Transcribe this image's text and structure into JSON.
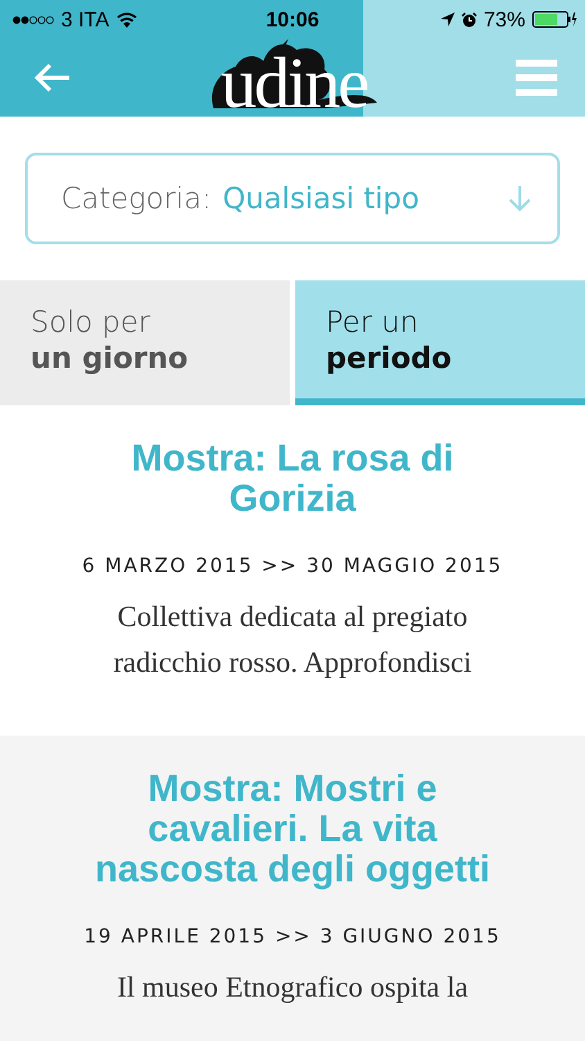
{
  "status_bar": {
    "carrier": "3 ITA",
    "time": "10:06",
    "battery": "73%"
  },
  "header": {
    "logo": "udine"
  },
  "filter": {
    "label": "Categoria:",
    "value": "Qualsiasi tipo"
  },
  "tabs": [
    {
      "lines": [
        "Solo per",
        "un giorno"
      ],
      "selected": false
    },
    {
      "lines": [
        "Per un",
        "periodo"
      ],
      "selected": true
    }
  ],
  "events": [
    {
      "title": "Mostra: La rosa di Gorizia",
      "dates": "6 MARZO 2015 >> 30 MAGGIO 2015",
      "description": "Collettiva dedicata al pregiato radicchio rosso. Approfondisci"
    },
    {
      "title": "Mostra: Mostri e cavalieri. La vita nascosta degli oggetti",
      "dates": "19 APRILE 2015 >> 3 GIUGNO 2015",
      "description": "Il museo Etnografico ospita la"
    }
  ]
}
